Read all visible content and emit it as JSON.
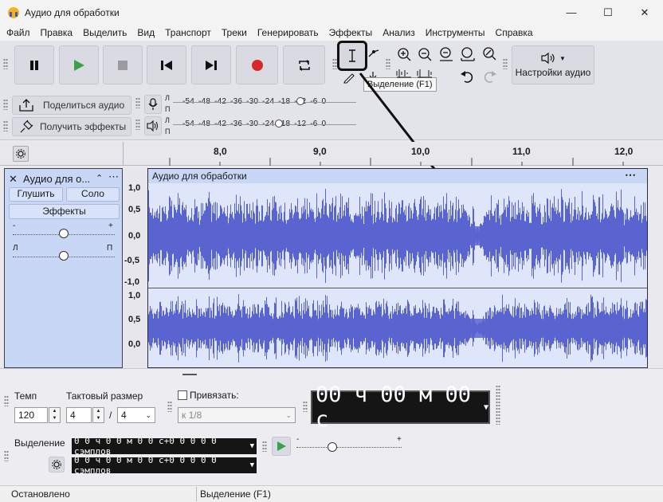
{
  "window": {
    "title": "Аудио для обработки"
  },
  "menu": [
    "Файл",
    "Правка",
    "Выделить",
    "Вид",
    "Транспорт",
    "Треки",
    "Генерировать",
    "Эффекты",
    "Анализ",
    "Инструменты",
    "Справка"
  ],
  "toolbar": {
    "share_label": "Поделиться аудио",
    "get_effects_label": "Получить эффекты",
    "audio_settings_label": "Настройки аудио",
    "tooltip": "Выделение (F1)",
    "meter_scale": "-54 -48 -42 -36 -30 -24 -18 -12 -6 0",
    "meter_scale_play": "-54 -48 -42 -36 -30 -24 -18 -12 -6 0",
    "meter_l": "Л",
    "meter_r": "П"
  },
  "ruler": {
    "ticks": [
      "8,0",
      "9,0",
      "10,0",
      "11,0",
      "12,0"
    ]
  },
  "track": {
    "name": "Аудио для о...",
    "clip_name": "Аудио для обработки",
    "mute_label": "Глушить",
    "solo_label": "Соло",
    "effects_label": "Эффекты",
    "gain_minus": "-",
    "gain_plus": "+",
    "pan_left": "Л",
    "pan_right": "П",
    "scale_top": [
      "1,0",
      "0,5",
      "0,0",
      "-0,5",
      "-1,0"
    ],
    "scale_bottom": [
      "1,0",
      "0,5",
      "0,0"
    ]
  },
  "bottom": {
    "tempo_label": "Темп",
    "tempo_value": "120",
    "timesig_label": "Тактовый размер",
    "timesig_num": "4",
    "timesig_sep": "/",
    "timesig_den": "4",
    "snap_label": "Привязать:",
    "snap_value": "к 1/8",
    "time_display": "00 ч 00 м 00 с",
    "selection_label": "Выделение",
    "sel_start": "0 0 ч 0 0 м 0 0 с+0 0 0 0 0 сэмплов",
    "sel_end": "0 0 ч 0 0 м 0 0 с+0 0 0 0 0 сэмплов",
    "speed_minus": "-",
    "speed_plus": "+"
  },
  "status": {
    "left": "Остановлено",
    "right": "Выделение (F1)"
  },
  "colors": {
    "waveform": "#5a64d0",
    "clip_header": "#c9d7f7",
    "accent_green": "#3aa04a",
    "record_red": "#d6282b"
  }
}
